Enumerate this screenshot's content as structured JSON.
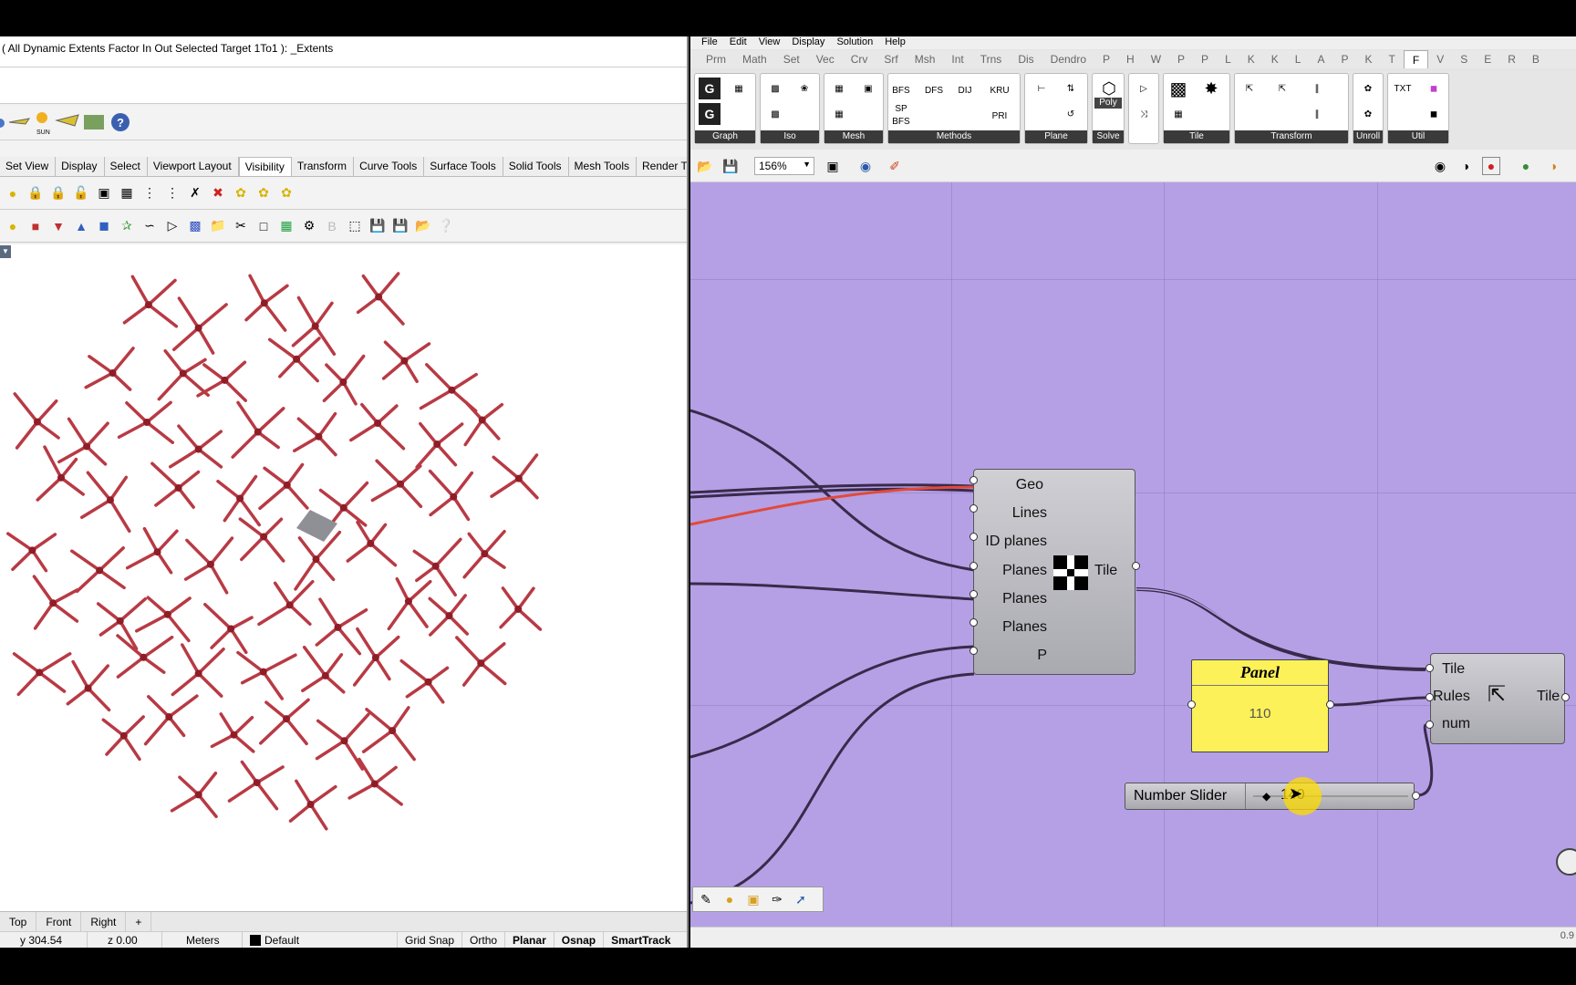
{
  "rhino": {
    "command_line": "( All  Dynamic  Extents  Factor  In  Out  Selected  Target  1To1 ): _Extents",
    "ribbon_tabs": [
      "Set View",
      "Display",
      "Select",
      "Viewport Layout",
      "Visibility",
      "Transform",
      "Curve Tools",
      "Surface Tools",
      "Solid Tools",
      "Mesh Tools",
      "Render Tools"
    ],
    "active_tab": "Visibility",
    "sun_label": "SUN",
    "viewport_tabs": [
      "Top",
      "Front",
      "Right"
    ],
    "add_tab_icon": "+",
    "status": {
      "y": "y 304.54",
      "z": "z 0.00",
      "units": "Meters",
      "layer": "Default",
      "grid_snap": "Grid Snap",
      "ortho": "Ortho",
      "planar": "Planar",
      "osnap": "Osnap",
      "smarttrack": "SmartTrack"
    }
  },
  "gh": {
    "menu": [
      "File",
      "Edit",
      "View",
      "Display",
      "Solution",
      "Help"
    ],
    "tabs": [
      "Prm",
      "Math",
      "Set",
      "Vec",
      "Crv",
      "Srf",
      "Msh",
      "Int",
      "Trns",
      "Dis",
      "Dendro",
      "P",
      "H",
      "W",
      "P",
      "P",
      "L",
      "K",
      "K",
      "L",
      "A",
      "P",
      "K",
      "T",
      "F",
      "V",
      "S",
      "E",
      "R",
      "B"
    ],
    "active_tab": "F",
    "ribbon_groups": {
      "graph": "Graph",
      "iso": "Iso",
      "mesh": "Mesh",
      "methods": "Methods",
      "plane": "Plane",
      "solve": "Solve",
      "tile": "Tile",
      "transform": "Transform",
      "unroll": "Unroll",
      "util": "Util"
    },
    "ribbon_text": {
      "bfs": "BFS",
      "dfs": "DFS",
      "dij": "DIJ",
      "kru": "KRU",
      "sp": "SP",
      "bfs2": "BFS",
      "pri": "PRI",
      "poly": "Poly",
      "txt": "TXT",
      "g1": "G",
      "g2": "G"
    },
    "zoom": "156%",
    "components": {
      "tile_main": {
        "inputs": [
          "Geo",
          "Lines",
          "ID planes",
          "Planes",
          "Planes",
          "Planes",
          "P"
        ],
        "output": "Tile"
      },
      "panel": {
        "title": "Panel",
        "value": "110"
      },
      "tile_rules": {
        "inputs": [
          "Tile",
          "Rules",
          "num"
        ],
        "output": "Tile"
      },
      "slider": {
        "label": "Number Slider",
        "value": "140"
      }
    },
    "version": "0.9"
  },
  "colors": {
    "canvas": "#b5a0e6",
    "panel": "#fdf15a",
    "wire": "#3a2a4a",
    "wire_selected": "#e04a3a",
    "lattice": "#b83a44"
  }
}
